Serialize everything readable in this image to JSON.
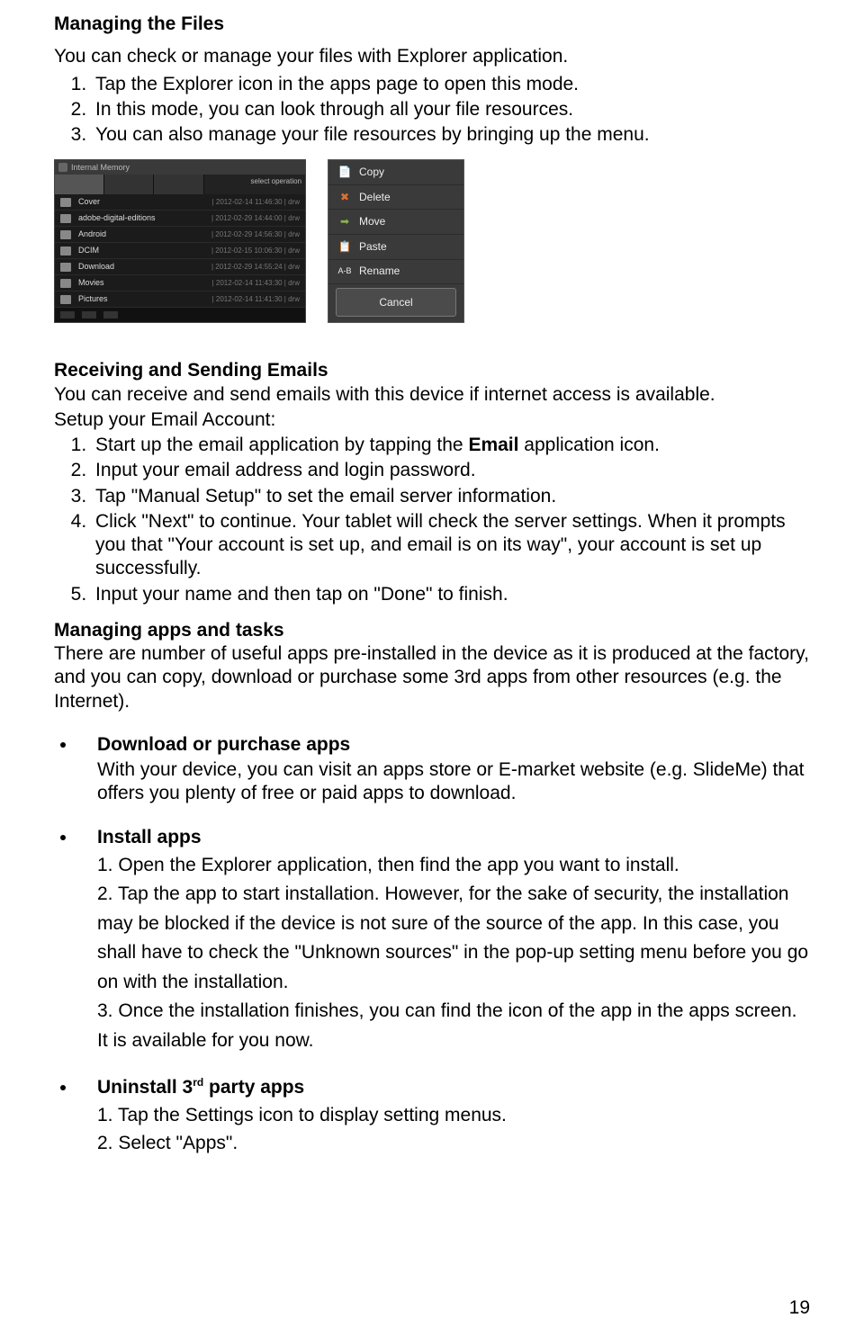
{
  "section1": {
    "title": "Managing the Files",
    "intro": "You can check or manage your files with Explorer application.",
    "items": [
      "Tap the Explorer icon in the apps page to open this mode.",
      "In this mode, you can look through all your file resources.",
      "You can also manage your file resources by bringing up the menu."
    ]
  },
  "explorer": {
    "header": "Internal Memory",
    "otherTab": "select operation",
    "rows": [
      {
        "name": "Cover",
        "stamp": "| 2012-02-14 11:46:30 | drw"
      },
      {
        "name": "adobe-digital-editions",
        "stamp": "| 2012-02-29 14:44:00 | drw"
      },
      {
        "name": "Android",
        "stamp": "| 2012-02-29 14:56:30 | drw"
      },
      {
        "name": "DCIM",
        "stamp": "| 2012-02-15 10:06:30 | drw"
      },
      {
        "name": "Download",
        "stamp": "| 2012-02-29 14:55:24 | drw"
      },
      {
        "name": "Movies",
        "stamp": "| 2012-02-14 11:43:30 | drw"
      },
      {
        "name": "Pictures",
        "stamp": "| 2012-02-14 11:41:30 | drw"
      }
    ]
  },
  "menu": {
    "items": [
      {
        "icon": "📄",
        "label": "Copy"
      },
      {
        "icon": "✖",
        "label": "Delete"
      },
      {
        "icon": "➡",
        "label": "Move"
      },
      {
        "icon": "📋",
        "label": "Paste"
      },
      {
        "icon": "A-B",
        "label": "Rename"
      }
    ],
    "cancel": "Cancel"
  },
  "section2": {
    "title": "Receiving and Sending Emails",
    "intro": "You can receive and send emails with this device if internet access is available.",
    "setup": "Setup your Email Account:",
    "items": [
      "Start up the email application by tapping the <b>Email</b> application icon.",
      "Input your email address and login password.",
      "Tap \"Manual Setup\" to set the email server information.",
      "Click \"Next\" to continue. Your tablet will check the server settings. When it prompts you that \"Your account is set up, and email is on its way\", your account is set up successfully.",
      "Input your name and then tap on \"Done\" to finish."
    ]
  },
  "section3": {
    "title": "Managing apps and tasks",
    "intro": "There are number of useful apps pre-installed in the device as it is produced at the factory, and you can copy, download or purchase some 3rd apps from other resources (e.g. the Internet)."
  },
  "bullets": [
    {
      "title": "Download or purchase apps",
      "body": "With your device, you can visit an apps store or E-market website (e.g. SlideMe) that offers you plenty of free or paid apps to download."
    },
    {
      "title": "Install apps",
      "numbered": [
        "Open the Explorer application, then find the app you want to install.",
        "Tap the app to start installation. However, for the sake of security, the installation may be blocked if the device is not sure of the source of the app. In this case, you shall have to check the \"Unknown sources\" in the pop-up setting menu before you go on with the installation.",
        "Once the installation finishes, you can find the icon of the app in the apps screen. It is available for you now."
      ]
    },
    {
      "title_pre": "Uninstall 3",
      "title_sup": "rd",
      "title_post": " party apps",
      "numbered": [
        "Tap the Settings icon to display setting menus.",
        "Select \"Apps\"."
      ]
    }
  ],
  "page_number": "19"
}
